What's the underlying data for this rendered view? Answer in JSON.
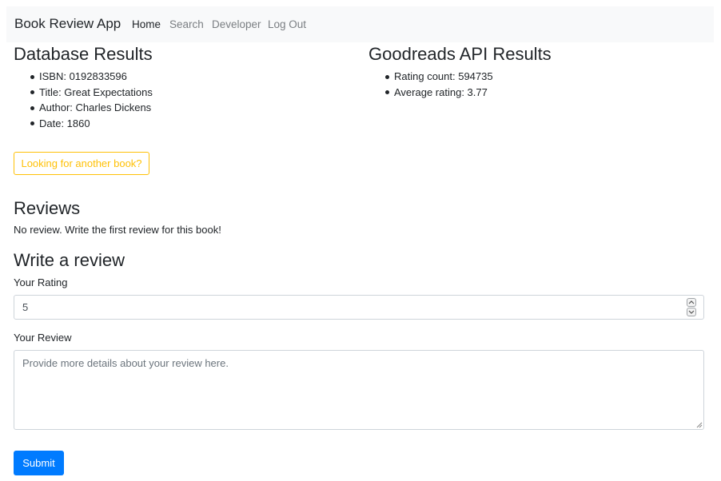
{
  "navbar": {
    "brand": "Book Review App",
    "links": [
      {
        "label": "Home",
        "active": true
      },
      {
        "label": "Search",
        "active": false
      },
      {
        "label": "Developer",
        "active": false
      },
      {
        "label": "Log Out",
        "active": false
      }
    ]
  },
  "database": {
    "title": "Database Results",
    "items": [
      "ISBN: 0192833596",
      "Title: Great Expectations",
      "Author: Charles Dickens",
      "Date: 1860"
    ]
  },
  "goodreads": {
    "title": "Goodreads API Results",
    "items": [
      "Rating count: 594735",
      "Average rating: 3.77"
    ]
  },
  "another_book_button": "Looking for another book?",
  "reviews": {
    "title": "Reviews",
    "empty_message": "No review. Write the first review for this book!"
  },
  "write_review": {
    "title": "Write a review",
    "rating_label": "Your Rating",
    "rating_value": "5",
    "review_label": "Your Review",
    "review_placeholder": "Provide more details about your review here.",
    "submit_label": "Submit"
  },
  "colors": {
    "primary": "#007bff",
    "warning": "#ffc107",
    "navbar_bg": "#f8f9fa",
    "text": "#212529",
    "muted_nav": "#7a7e82"
  }
}
